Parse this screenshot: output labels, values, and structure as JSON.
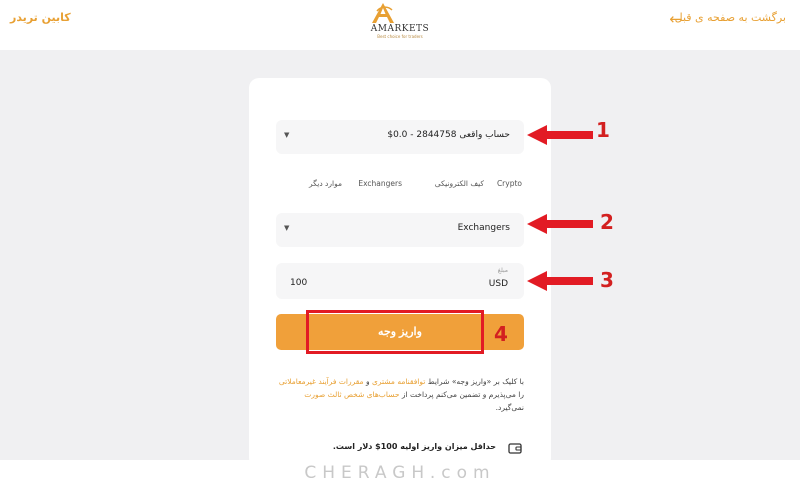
{
  "header": {
    "back_label": "برگشت به صفحه ی قبل",
    "cabinet_label": "کابین تریدر",
    "logo_word": "AMARKETS",
    "logo_tagline": "Best choice for traders"
  },
  "form": {
    "account_select": "حساب واقعی 2844758 - 0.0$",
    "method_tabs": [
      {
        "label": "Crypto"
      },
      {
        "label": "کیف الکترونیکی"
      },
      {
        "label": "Exchangers"
      },
      {
        "label": "موارد دیگر"
      }
    ],
    "method_select": "Exchangers",
    "amount_label": "مبلغ",
    "currency": "USD",
    "amount": "100",
    "deposit_button": "واریز وجه",
    "terms": {
      "part1": "با کلیک بر «واریز وجه» شرایط ",
      "link1": "توافقنامه مشتری",
      "part2": " و ",
      "link2": "مقررات فرآیند غیرمعاملاتی",
      "part3": " را می‌پذیرم و تضمین می‌کنم پرداخت از ",
      "link3": "حساب‌های شخص ثالث صورت",
      "part4": " نمی‌گیرد."
    },
    "min_deposit": "حداقل میزان واریز اولیه 100$ دلار است."
  },
  "annotations": {
    "numbers": [
      "1",
      "2",
      "3",
      "4"
    ],
    "color": "#d32020"
  },
  "watermark": "CHERAGH.com",
  "colors": {
    "accent": "#f0a03a",
    "link": "#e8a033",
    "highlight": "#e21b24"
  }
}
